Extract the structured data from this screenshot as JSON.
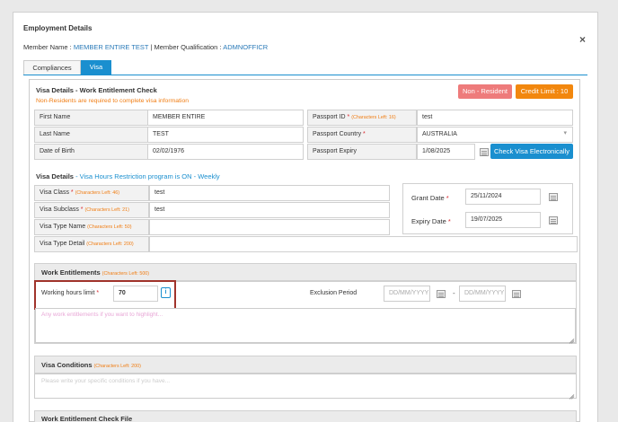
{
  "header": {
    "title": "Employment Details",
    "member_name_label": "Member Name : ",
    "member_name": "MEMBER ENTIRE TEST",
    "separator": " | ",
    "member_qualification_label": "Member Qualification : ",
    "member_qualification": "ADMNOFFICR",
    "close": "×"
  },
  "tabs": [
    {
      "label": "Compliances",
      "active": false
    },
    {
      "label": "Visa",
      "active": true
    }
  ],
  "visa_check": {
    "title": "Visa Details - Work Entitlement Check",
    "warning": "Non-Residents are required to complete visa information",
    "non_resident_button": "Non - Resident",
    "credit_limit_button": "Credit Limit : 10",
    "check_visa_button": "Check Visa Electronically",
    "first_name_label": "First Name",
    "first_name_value": "MEMBER ENTIRE",
    "last_name_label": "Last Name",
    "last_name_value": "TEST",
    "dob_label": "Date of Birth",
    "dob_value": "02/02/1976",
    "passport_id_label": "Passport ID",
    "passport_id_note": "(Characters Left: 16)",
    "passport_id_value": "test",
    "passport_country_label": "Passport Country",
    "passport_country_value": "AUSTRALIA",
    "passport_expiry_label": "Passport Expiry",
    "passport_expiry_value": "1/08/2025",
    "required_star": "*"
  },
  "visa_details": {
    "title": "Visa Details",
    "subtitle": " - Visa Hours Restriction program is ON - Weekly",
    "class_label": "Visa Class",
    "class_note": "(Characters Left: 46)",
    "class_value": "test",
    "subclass_label": "Visa Subclass",
    "subclass_note": "(Characters Left: 21)",
    "subclass_value": "test",
    "type_name_label": "Visa Type Name",
    "type_name_note": "(Characters Left: 50)",
    "type_name_value": "",
    "type_detail_label": "Visa Type Detail",
    "type_detail_note": "(Characters Left: 200)",
    "type_detail_value": "",
    "grant_date_label": "Grant Date",
    "grant_date_value": "25/11/2024",
    "expiry_date_label": "Expiry Date",
    "expiry_date_value": "19/07/2025"
  },
  "work_entitlements": {
    "title": "Work Entitlements",
    "note": "(Characters Left: 500)",
    "hours_label": "Working hours limit",
    "hours_value": "70",
    "info_icon": "i",
    "exclusion_label": "Exclusion Period",
    "date_placeholder_from": "DD/MM/YYYY",
    "date_placeholder_to": "DD/MM/YYYY",
    "dash": "-",
    "textarea_placeholder": "Any work entitlements if you want to highlight..."
  },
  "visa_conditions": {
    "title": "Visa Conditions",
    "note": "(Characters Left: 200)",
    "textarea_placeholder": "Please write your specific conditions if you have..."
  },
  "work_check_file": {
    "title": "Work Entitlement Check File"
  },
  "colors": {
    "accent": "#1a8fcf",
    "warning": "#f07d13",
    "non_resident": "#ee7b7b",
    "highlight_border": "#a0332b"
  }
}
